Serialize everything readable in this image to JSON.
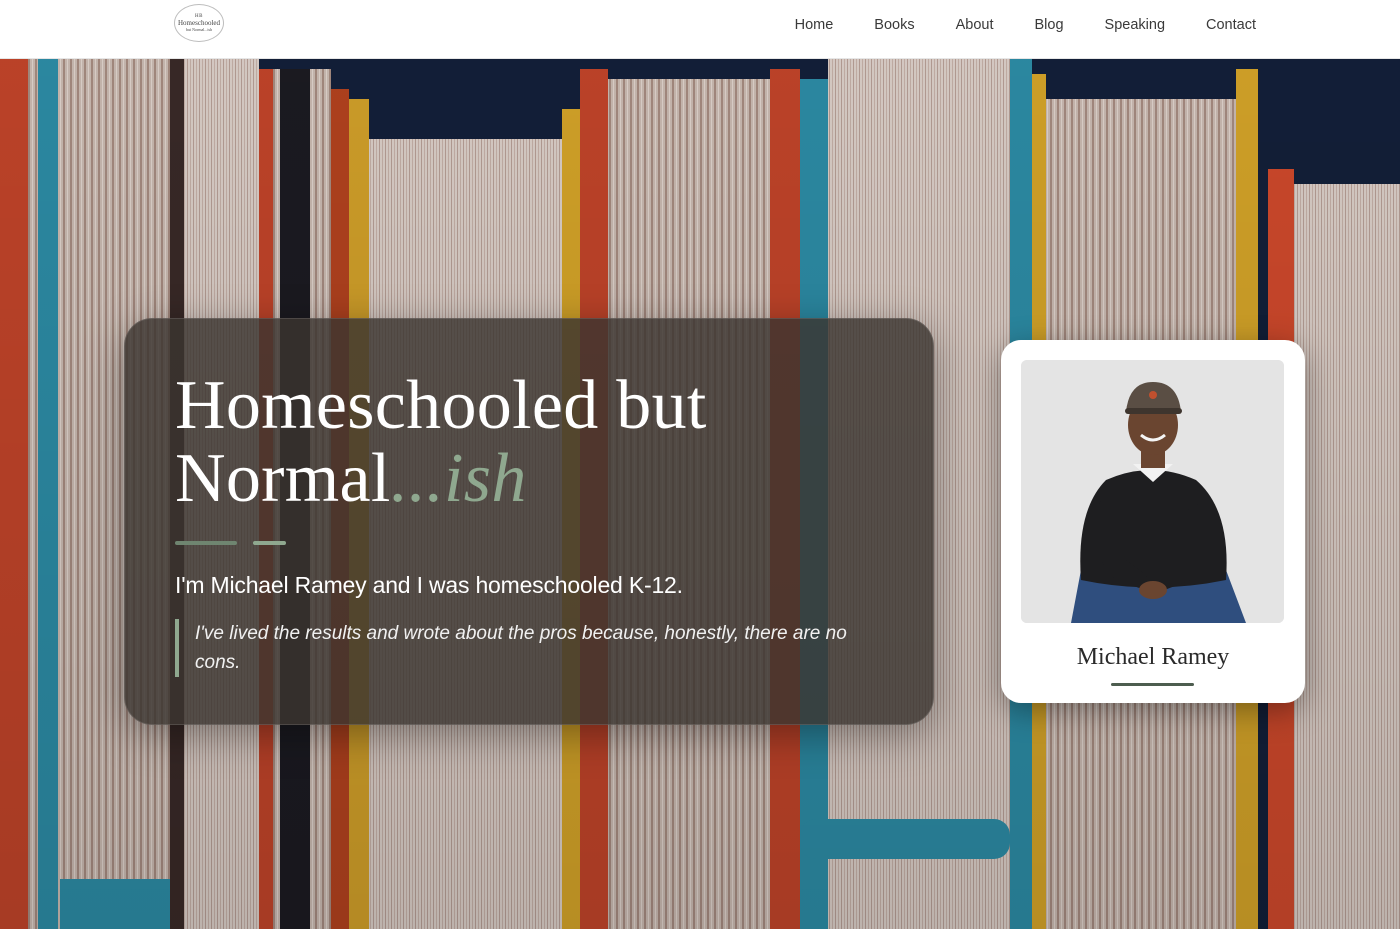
{
  "logo": {
    "mark": "HB",
    "name": "Homeschooled",
    "tagline": "but Normal...ish"
  },
  "nav": {
    "items": [
      "Home",
      "Books",
      "About",
      "Blog",
      "Speaking",
      "Contact"
    ]
  },
  "hero": {
    "title_line1": "Homeschooled but",
    "title_line2": "Normal",
    "title_accent": "...ish",
    "intro": "I'm Michael Ramey and I was homeschooled K-12.",
    "quote": "I've lived the results and wrote about the pros because, honestly, there are no cons."
  },
  "profile": {
    "name": "Michael Ramey"
  },
  "colors": {
    "accent": "#8fa88f",
    "accent_dark": "#6f8570",
    "card_bg": "#3a3430",
    "nav_text": "#3a3a3a"
  }
}
